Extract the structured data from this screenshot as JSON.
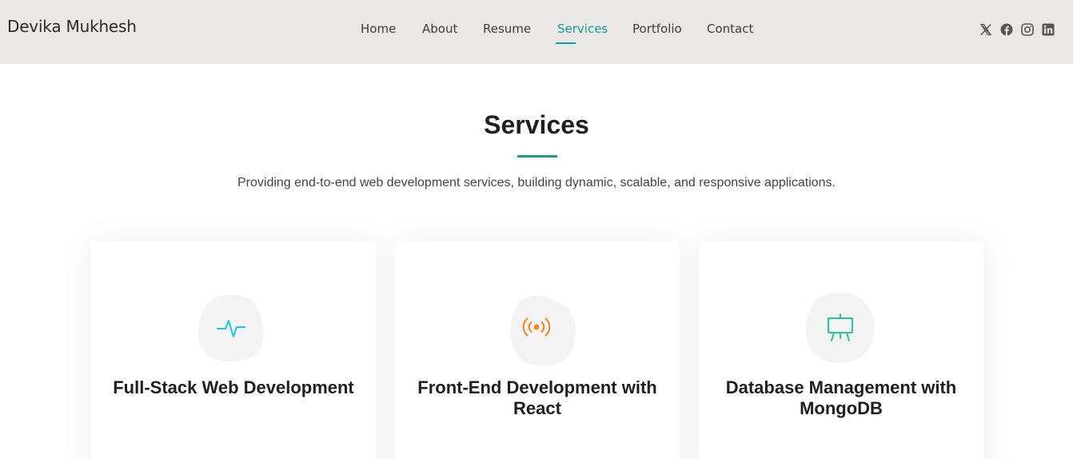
{
  "header": {
    "logo": "Devika Mukhesh",
    "nav": [
      {
        "label": "Home",
        "active": false
      },
      {
        "label": "About",
        "active": false
      },
      {
        "label": "Resume",
        "active": false
      },
      {
        "label": "Services",
        "active": true
      },
      {
        "label": "Portfolio",
        "active": false
      },
      {
        "label": "Contact",
        "active": false
      }
    ],
    "social": [
      "x-twitter-icon",
      "facebook-icon",
      "instagram-icon",
      "linkedin-icon"
    ]
  },
  "section": {
    "title": "Services",
    "subtitle": "Providing end-to-end web development services, building dynamic, scalable, and responsive applications."
  },
  "cards": [
    {
      "title": "Full-Stack Web Development",
      "icon": "activity-icon",
      "icon_color": "#0dcaf0"
    },
    {
      "title": "Front-End Development with React",
      "icon": "broadcast-icon",
      "icon_color": "#fd7e14"
    },
    {
      "title": "Database Management with MongoDB",
      "icon": "easel-icon",
      "icon_color": "#20c997"
    }
  ],
  "colors": {
    "accent": "#149e8f",
    "header_bg": "#e9e8e6"
  }
}
